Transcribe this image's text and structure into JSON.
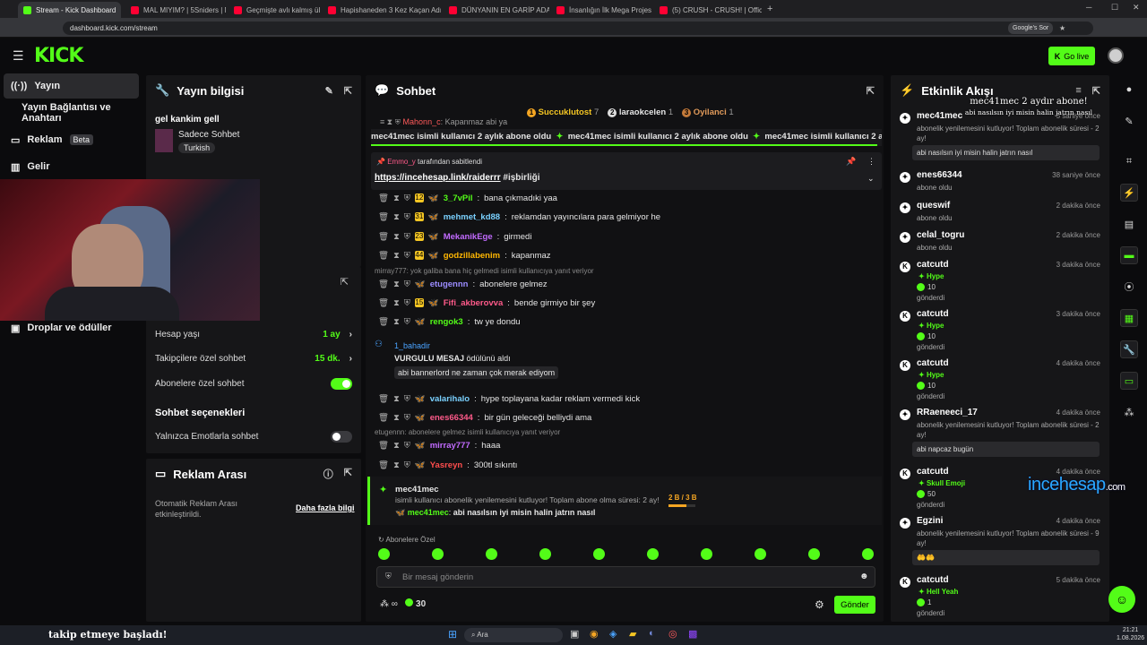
{
  "browser": {
    "tabs": [
      {
        "label": "Stream - Kick Dashboard",
        "active": true,
        "color": "#53fc18"
      },
      {
        "label": "MAL MIYIM? | 5Sniders | Motosi...",
        "color": "#ff0033"
      },
      {
        "label": "Geçmişte avlı kalmış ülke: Kübi...",
        "color": "#ff0033"
      },
      {
        "label": "Hapishaneden 3 Kez Kaçan Adı...",
        "color": "#ff0033"
      },
      {
        "label": "DÜNYANIN EN GARİP ADASIN...",
        "color": "#ff0033"
      },
      {
        "label": "İnsanlığın İlk Mega Projesi Göb...",
        "color": "#ff0033"
      },
      {
        "label": "(5) CRUSH - CRUSH! | Official M...",
        "color": "#ff0033"
      }
    ],
    "url": "dashboard.kick.com/stream",
    "google_label": "Google's Sor"
  },
  "header": {
    "logo": "KICK",
    "golive": "Go live"
  },
  "sidebar": {
    "items": [
      {
        "label": "Yayın",
        "icon": "broadcast-icon"
      },
      {
        "label": "Yayın Bağlantısı ve Anahtarı"
      },
      {
        "label": "Reklam",
        "badge": "Beta",
        "icon": "ad-icon"
      },
      {
        "label": "Gelir",
        "icon": "chart-icon"
      },
      {
        "label": "Droplar ve ödüller",
        "icon": "gift-icon"
      }
    ]
  },
  "stream_info": {
    "title": "Yayın bilgisi",
    "stream_title": "gel kankim gell",
    "category": "Sadece Sohbet",
    "language": "Turkish"
  },
  "chat_settings": {
    "account_age_label": "Hesap yaşı",
    "account_age_value": "1 ay",
    "followers_label": "Takipçilere özel sohbet",
    "followers_value": "15 dk.",
    "subs_label": "Abonelere özel sohbet",
    "section": "Sohbet seçenekleri",
    "emote_only": "Yalnızca Emotlarla sohbet"
  },
  "ad_break": {
    "title": "Reklam Arası",
    "desc": "Otomatik Reklam Arası etkinleştirildi.",
    "link": "Daha fazla bilgi"
  },
  "chat": {
    "title": "Sohbet",
    "top": [
      {
        "rank": "1",
        "name": "Succuklutost",
        "count": "7"
      },
      {
        "rank": "2",
        "name": "laraokcelen",
        "count": "1"
      },
      {
        "rank": "3",
        "name": "Oyilanci",
        "count": "1"
      }
    ],
    "ticker_user": "Mahonn_c",
    "ticker_text": "Kapanmaz abi ya",
    "banner": "mec41mec isimli kullanıcı 2 aylık abone oldu",
    "pinned_by": "Emmo_y",
    "pinned_suffix": "tarafından sabitlendi",
    "pinned_link": "https://incehesap.link/raiderrr",
    "pinned_tag": "#işbirliği",
    "messages": [
      {
        "user": "3_7vPil",
        "color": "#53fc18",
        "text": "bana çıkmadıki yaa",
        "badge": "12"
      },
      {
        "user": "mehmet_kd88",
        "color": "#7ad1ff",
        "text": "reklamdan yayıncılara para gelmiyor he",
        "badge": "31"
      },
      {
        "user": "MekanikEge",
        "color": "#c26bff",
        "text": "girmedi",
        "badge": "23"
      },
      {
        "user": "godzillabenim",
        "color": "#ffb703",
        "text": "kapanmaz",
        "badge": "44"
      },
      {
        "user": "etugennn",
        "color": "#9b8cff",
        "text": "abonelere gelmez",
        "reply": "mirray777: yok galiba bana hiç gelmedi isimli kullanıcıya yanıt veriyor"
      },
      {
        "user": "Fifi_akberovva",
        "color": "#ff5a8a",
        "text": "bende girmiyo bir şey",
        "badge": "15"
      },
      {
        "user": "rengok3",
        "color": "#53fc18",
        "text": "tw ye dondu"
      }
    ],
    "highlight": {
      "user": "1_bahadir",
      "label": "VURGULU MESAJ",
      "suffix": "ödülünü aldı",
      "text": "abi bannerlord ne zaman çok merak ediyom"
    },
    "messages2": [
      {
        "user": "valarihalo",
        "color": "#7ad1ff",
        "text": "hype toplayana kadar reklam vermedi kick"
      },
      {
        "user": "enes66344",
        "color": "#ff5a8a",
        "text": "bir gün geleceği belliydi ama"
      },
      {
        "user": "mirray777",
        "color": "#c26bff",
        "text": "haaa",
        "reply": "etugennn: abonelere gelmez isimli kullanıcıya yanıt veriyor"
      },
      {
        "user": "Yasreyn",
        "color": "#ff4d4d",
        "text": "300tl sıkıntı"
      }
    ],
    "resub": {
      "user": "mec41mec",
      "text": "isimli kullanıcı abonelik yenilemesini kutluyor! Toplam abone olma süresi: 2 ay!",
      "progress": "2 B / 3 B",
      "msg_user": "mec41mec",
      "msg": "abi nasılsın iyi misin halin jatrın nasıl"
    },
    "subs_label": "Abonelere Özel",
    "placeholder": "Bir mesaj gönderin",
    "points": "30",
    "send": "Gönder"
  },
  "activity": {
    "title": "Etkinlik Akışı",
    "overlay_line1": "mec41mec 2 aydır abone!",
    "overlay_line2": "abi nasılsın iyi misin halin jatrın nasıl",
    "events": [
      {
        "name": "mec41mec",
        "time": "5 saniye önce",
        "sub": "abonelik yenilemesini kutluyor! Toplam abonelik süresi - 2 ay!",
        "box": "abi nasılsın iyi misin halin jatrın nasıl"
      },
      {
        "name": "enes66344",
        "time": "38 saniye önce",
        "sub": "abone oldu"
      },
      {
        "name": "queswif",
        "time": "2 dakika önce",
        "sub": "abone oldu"
      },
      {
        "name": "celal_togru",
        "time": "2 dakika önce",
        "sub": "abone oldu"
      },
      {
        "name": "catcutd",
        "time": "3 dakika önce",
        "hype": "Hype",
        "amount": "10",
        "sent": "gönderdi"
      },
      {
        "name": "catcutd",
        "time": "3 dakika önce",
        "hype": "Hype",
        "amount": "10",
        "sent": "gönderdi"
      },
      {
        "name": "catcutd",
        "time": "4 dakika önce",
        "hype": "Hype",
        "amount": "10",
        "sent": "gönderdi"
      },
      {
        "name": "RRaeneeci_17",
        "time": "4 dakika önce",
        "sub": "abonelik yenilemesini kutluyor! Toplam abonelik süresi - 2 ay!",
        "box": "abi napcaz bugün"
      },
      {
        "name": "catcutd",
        "time": "4 dakika önce",
        "hype": "Skull Emoji",
        "amount": "50",
        "sent": "gönderdi"
      },
      {
        "name": "Egzini",
        "time": "4 dakika önce",
        "sub": "abonelik yenilemesini kutluyor! Toplam abonelik süresi - 9 ay!",
        "box": "🤲🤲"
      },
      {
        "name": "catcutd",
        "time": "5 dakika önce",
        "hype": "Hell Yeah",
        "amount": "1",
        "sent": "gönderdi"
      }
    ]
  },
  "watermark": {
    "a": "incehesap",
    "b": ".com"
  },
  "footer": {
    "toast": "takip etmeye başladı!",
    "search": "Ara",
    "time": "21:21",
    "date": "1.08.2026"
  }
}
